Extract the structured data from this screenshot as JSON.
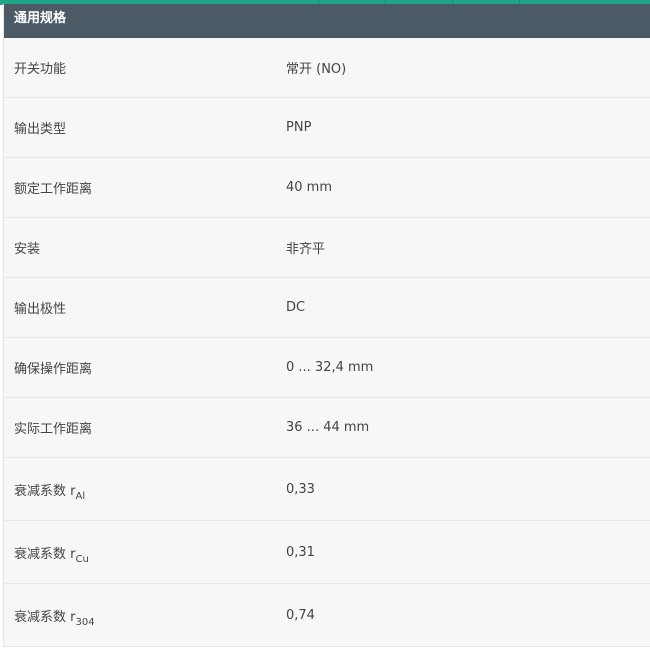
{
  "table": {
    "title": "通用规格",
    "rows": [
      {
        "label": "开关功能",
        "value": "常开 (NO)"
      },
      {
        "label": "输出类型",
        "value": "PNP"
      },
      {
        "label": "额定工作距离",
        "value": "40 mm"
      },
      {
        "label": "安装",
        "value": "非齐平"
      },
      {
        "label": "输出极性",
        "value": "DC"
      },
      {
        "label": "确保操作距离",
        "value": "0 ... 32,4 mm"
      },
      {
        "label": "实际工作距离",
        "value": "36 ... 44 mm"
      },
      {
        "label": "衰减系数 r",
        "label_sub": "Al",
        "value": "0,33"
      },
      {
        "label": "衰减系数 r",
        "label_sub": "Cu",
        "value": "0,31"
      },
      {
        "label": "衰减系数 r",
        "label_sub": "304",
        "value": "0,74"
      }
    ]
  },
  "colors": {
    "accent_strip": "#1fa58a",
    "header_bg": "#4b5a64",
    "row_bg": "#f7f7f7",
    "text": "#444444"
  }
}
